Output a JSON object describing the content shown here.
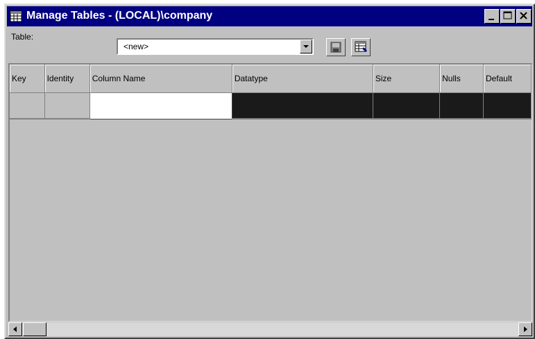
{
  "window": {
    "title": "Manage Tables - (LOCAL)\\company",
    "icon": "table-icon"
  },
  "title_buttons": {
    "minimize_icon": "minimize-icon",
    "maximize_icon": "maximize-icon",
    "close_icon": "close-icon"
  },
  "toolbar": {
    "table_label": "Table:",
    "table_select": {
      "selected": "<new>"
    },
    "save_icon": "save-icon",
    "properties_icon": "table-properties-icon"
  },
  "grid": {
    "columns": [
      "Key",
      "Identity",
      "Column Name",
      "Datatype",
      "Size",
      "Nulls",
      "Default"
    ]
  },
  "colors": {
    "titlebar": "#000080",
    "face": "#c0c0c0",
    "selected_row": "#1a1a1a"
  }
}
